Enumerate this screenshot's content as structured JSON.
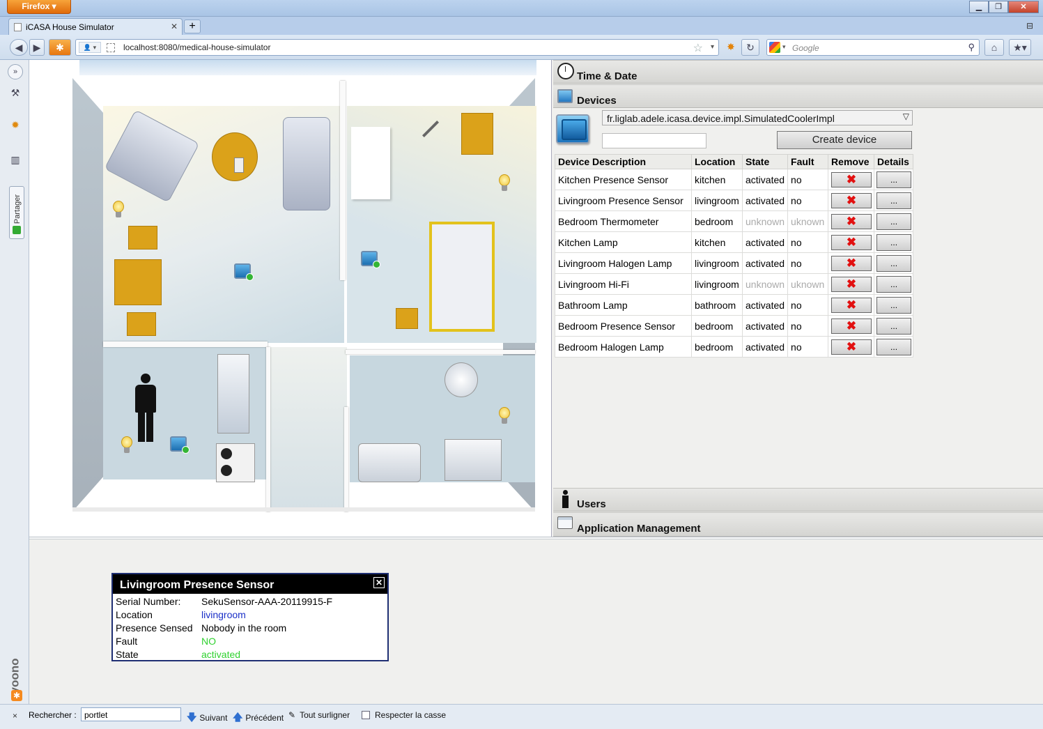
{
  "browser": {
    "menu_button": "Firefox",
    "tab_title": "iCASA House Simulator",
    "new_tab": "+",
    "url": "localhost:8080/medical-house-simulator",
    "search_placeholder": "Google",
    "window_controls": [
      "minimize-icon",
      "restore-icon",
      "close-icon"
    ]
  },
  "sidebar": {
    "partager_label": "Partager",
    "yoono_label": "yoono"
  },
  "panel": {
    "sections": {
      "time_date": "Time & Date",
      "devices": "Devices",
      "users": "Users",
      "app_management": "Application Management"
    },
    "device_type_selected": "fr.liglab.adele.icasa.device.impl.SimulatedCoolerImpl",
    "create_button": "Create device",
    "table_headers": [
      "Device Description",
      "Location",
      "State",
      "Fault",
      "Remove",
      "Details"
    ],
    "remove_glyph": "✖",
    "details_label": "...",
    "devices": [
      {
        "description": "Kitchen Presence Sensor",
        "location": "kitchen",
        "state": "activated",
        "fault": "no",
        "known": true
      },
      {
        "description": "Livingroom Presence Sensor",
        "location": "livingroom",
        "state": "activated",
        "fault": "no",
        "known": true
      },
      {
        "description": "Bedroom Thermometer",
        "location": "bedroom",
        "state": "unknown",
        "fault": "uknown",
        "known": false
      },
      {
        "description": "Kitchen Lamp",
        "location": "kitchen",
        "state": "activated",
        "fault": "no",
        "known": true
      },
      {
        "description": "Livingroom Halogen Lamp",
        "location": "livingroom",
        "state": "activated",
        "fault": "no",
        "known": true
      },
      {
        "description": "Livingroom Hi-Fi",
        "location": "livingroom",
        "state": "unknown",
        "fault": "uknown",
        "known": false
      },
      {
        "description": "Bathroom Lamp",
        "location": "bathroom",
        "state": "activated",
        "fault": "no",
        "known": true
      },
      {
        "description": "Bedroom Presence Sensor",
        "location": "bedroom",
        "state": "activated",
        "fault": "no",
        "known": true
      },
      {
        "description": "Bedroom Halogen Lamp",
        "location": "bedroom",
        "state": "activated",
        "fault": "no",
        "known": true
      }
    ]
  },
  "popup": {
    "title": "Livingroom Presence Sensor",
    "close": "✕",
    "rows": [
      {
        "key": "Serial Number:",
        "value": "SekuSensor-AAA-20119915-F",
        "color": "#000000"
      },
      {
        "key": "Location",
        "value": "livingroom",
        "color": "#1a2fc7"
      },
      {
        "key": "Presence Sensed",
        "value": "Nobody in the room",
        "color": "#000000"
      },
      {
        "key": "Fault",
        "value": "NO",
        "color": "#2fd12f"
      },
      {
        "key": "State",
        "value": "activated",
        "color": "#2fd12f"
      }
    ]
  },
  "findbar": {
    "close": "×",
    "label": "Rechercher :",
    "query": "portlet",
    "next": "Suivant",
    "previous": "Précédent",
    "highlight_all": "Tout surligner",
    "match_case": "Respecter la casse"
  }
}
